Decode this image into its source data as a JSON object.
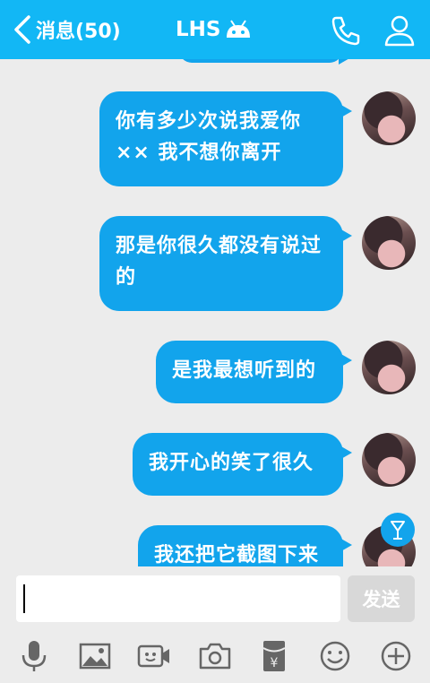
{
  "header": {
    "back_label": "消息(50)",
    "title": "LHS",
    "bg_color": "#12b7f5"
  },
  "messages": [
    {
      "text": "你有多少次说我爱你×× 我不想你离开"
    },
    {
      "text": "那是你很久都没有说过的"
    },
    {
      "text": "是我最想听到的"
    },
    {
      "text": "我开心的笑了很久"
    },
    {
      "text": "我还把它截图下来"
    }
  ],
  "composer": {
    "input_value": "",
    "send_label": "发送"
  },
  "icons": {
    "header": [
      "back-icon",
      "robot-icon",
      "phone-icon",
      "profile-icon"
    ],
    "toolbar": [
      "microphone-icon",
      "image-icon",
      "video-icon",
      "camera-icon",
      "red-packet-icon",
      "emoji-icon",
      "plus-icon"
    ]
  },
  "colors": {
    "accent": "#12b7f5",
    "bubble": "#12a4ec",
    "background": "#ececec"
  }
}
